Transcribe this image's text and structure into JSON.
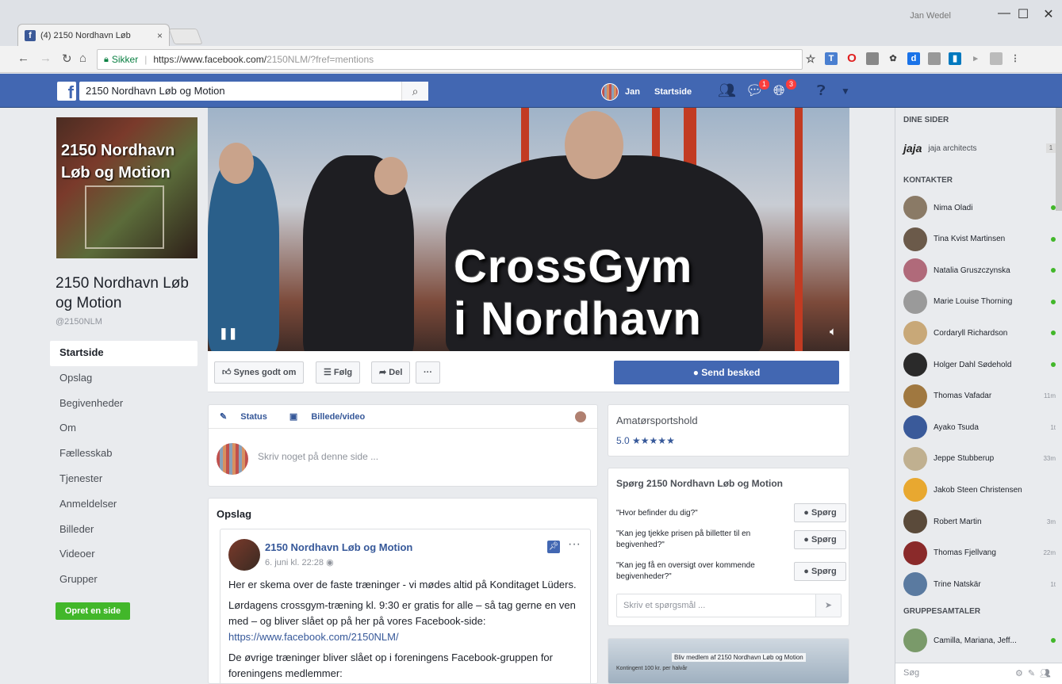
{
  "browser": {
    "tab_title": "(4) 2150 Nordhavn Løb",
    "tab_close": "×",
    "window_user": "Jan Wedel",
    "win_min": "—",
    "win_max": "☐",
    "win_close": "✕",
    "secure_label": "Sikker",
    "url_main": "https://www.facebook.com/",
    "url_path": "2150NLM/?fref=mentions"
  },
  "fb": {
    "search_value": "2150 Nordhavn Løb og Motion",
    "user_name": "Jan",
    "home_label": "Startside",
    "messages_badge": "1",
    "notifications_badge": "3"
  },
  "page": {
    "name": "2150 Nordhavn Løb og Motion",
    "handle": "@2150NLM",
    "profile_text": "2150 Nordhavn Løb og Motion",
    "nav": [
      "Startside",
      "Opslag",
      "Begivenheder",
      "Om",
      "Fællesskab",
      "Tjenester",
      "Anmeldelser",
      "Billeder",
      "Videoer",
      "Grupper"
    ],
    "create_page": "Opret en side",
    "cover_title_1": "CrossGym",
    "cover_title_2": "i Nordhavn",
    "like": "Synes godt om",
    "follow": "Følg",
    "share": "Del",
    "more": "···",
    "send_message": "Send besked"
  },
  "composer": {
    "status": "Status",
    "photo": "Billede/video",
    "placeholder": "Skriv noget på denne side ..."
  },
  "posts": {
    "title": "Opslag",
    "author": "2150 Nordhavn Løb og Motion",
    "time": "6. juni kl. 22:28",
    "p1": "Her er skema over de faste træninger - vi mødes altid på Konditaget Lüders.",
    "p2": "Lørdagens crossgym-træning kl. 9:30 er gratis for alle – så tag gerne en ven med – og bliver slået op på her på vores Facebook-side:",
    "link": "https://www.facebook.com/2150NLM/",
    "p3": "De øvrige træninger bliver slået op i foreningens Facebook-gruppen for foreningens medlemmer:"
  },
  "rating": {
    "category": "Amatørsportshold",
    "score": "5.0",
    "stars": "★★★★★"
  },
  "ask": {
    "title": "Spørg 2150 Nordhavn Løb og Motion",
    "questions": [
      "\"Hvor befinder du dig?\"",
      "\"Kan jeg tjekke prisen på billetter til en begivenhed?\"",
      "\"Kan jeg få en oversigt over kommende begivenheder?\""
    ],
    "button": "Spørg",
    "input_placeholder": "Skriv et spørgsmål ..."
  },
  "group_card": {
    "title": "Bliv medlem af 2150 Nordhavn Løb og Motion",
    "sub": "Kontingent 100 kr. per halvår"
  },
  "chat": {
    "your_pages": "DINE SIDER",
    "my_page": "jaja architects",
    "contacts_head": "KONTAKTER",
    "contacts": [
      {
        "name": "Nima Oladi",
        "status": "online",
        "color": "#8a7a66"
      },
      {
        "name": "Tina Kvist Martinsen",
        "status": "online",
        "color": "#6b5a4a"
      },
      {
        "name": "Natalia Gruszczynska",
        "status": "online",
        "color": "#b06a7a"
      },
      {
        "name": "Marie Louise Thorning",
        "status": "online",
        "color": "#9a9a9a"
      },
      {
        "name": "Cordaryll Richardson",
        "status": "online",
        "color": "#c8a878"
      },
      {
        "name": "Holger Dahl Sødehold",
        "status": "online",
        "color": "#2a2a2a"
      },
      {
        "name": "Thomas Vafadar",
        "status": "11m",
        "color": "#a07840"
      },
      {
        "name": "Ayako Tsuda",
        "status": "1t",
        "color": "#3a5a9a"
      },
      {
        "name": "Jeppe Stubberup",
        "status": "33m",
        "color": "#c0b090"
      },
      {
        "name": "Jakob Steen Christensen",
        "status": "",
        "color": "#e8a830"
      },
      {
        "name": "Robert Martin",
        "status": "3m",
        "color": "#5a4a3a"
      },
      {
        "name": "Thomas Fjellvang",
        "status": "22m",
        "color": "#8a2a2a"
      },
      {
        "name": "Trine Natskär",
        "status": "1t",
        "color": "#5a7aa0"
      }
    ],
    "groups_head": "GRUPPESAMTALER",
    "group_chat": "Camilla, Mariana, Jeff...",
    "search_placeholder": "Søg"
  }
}
